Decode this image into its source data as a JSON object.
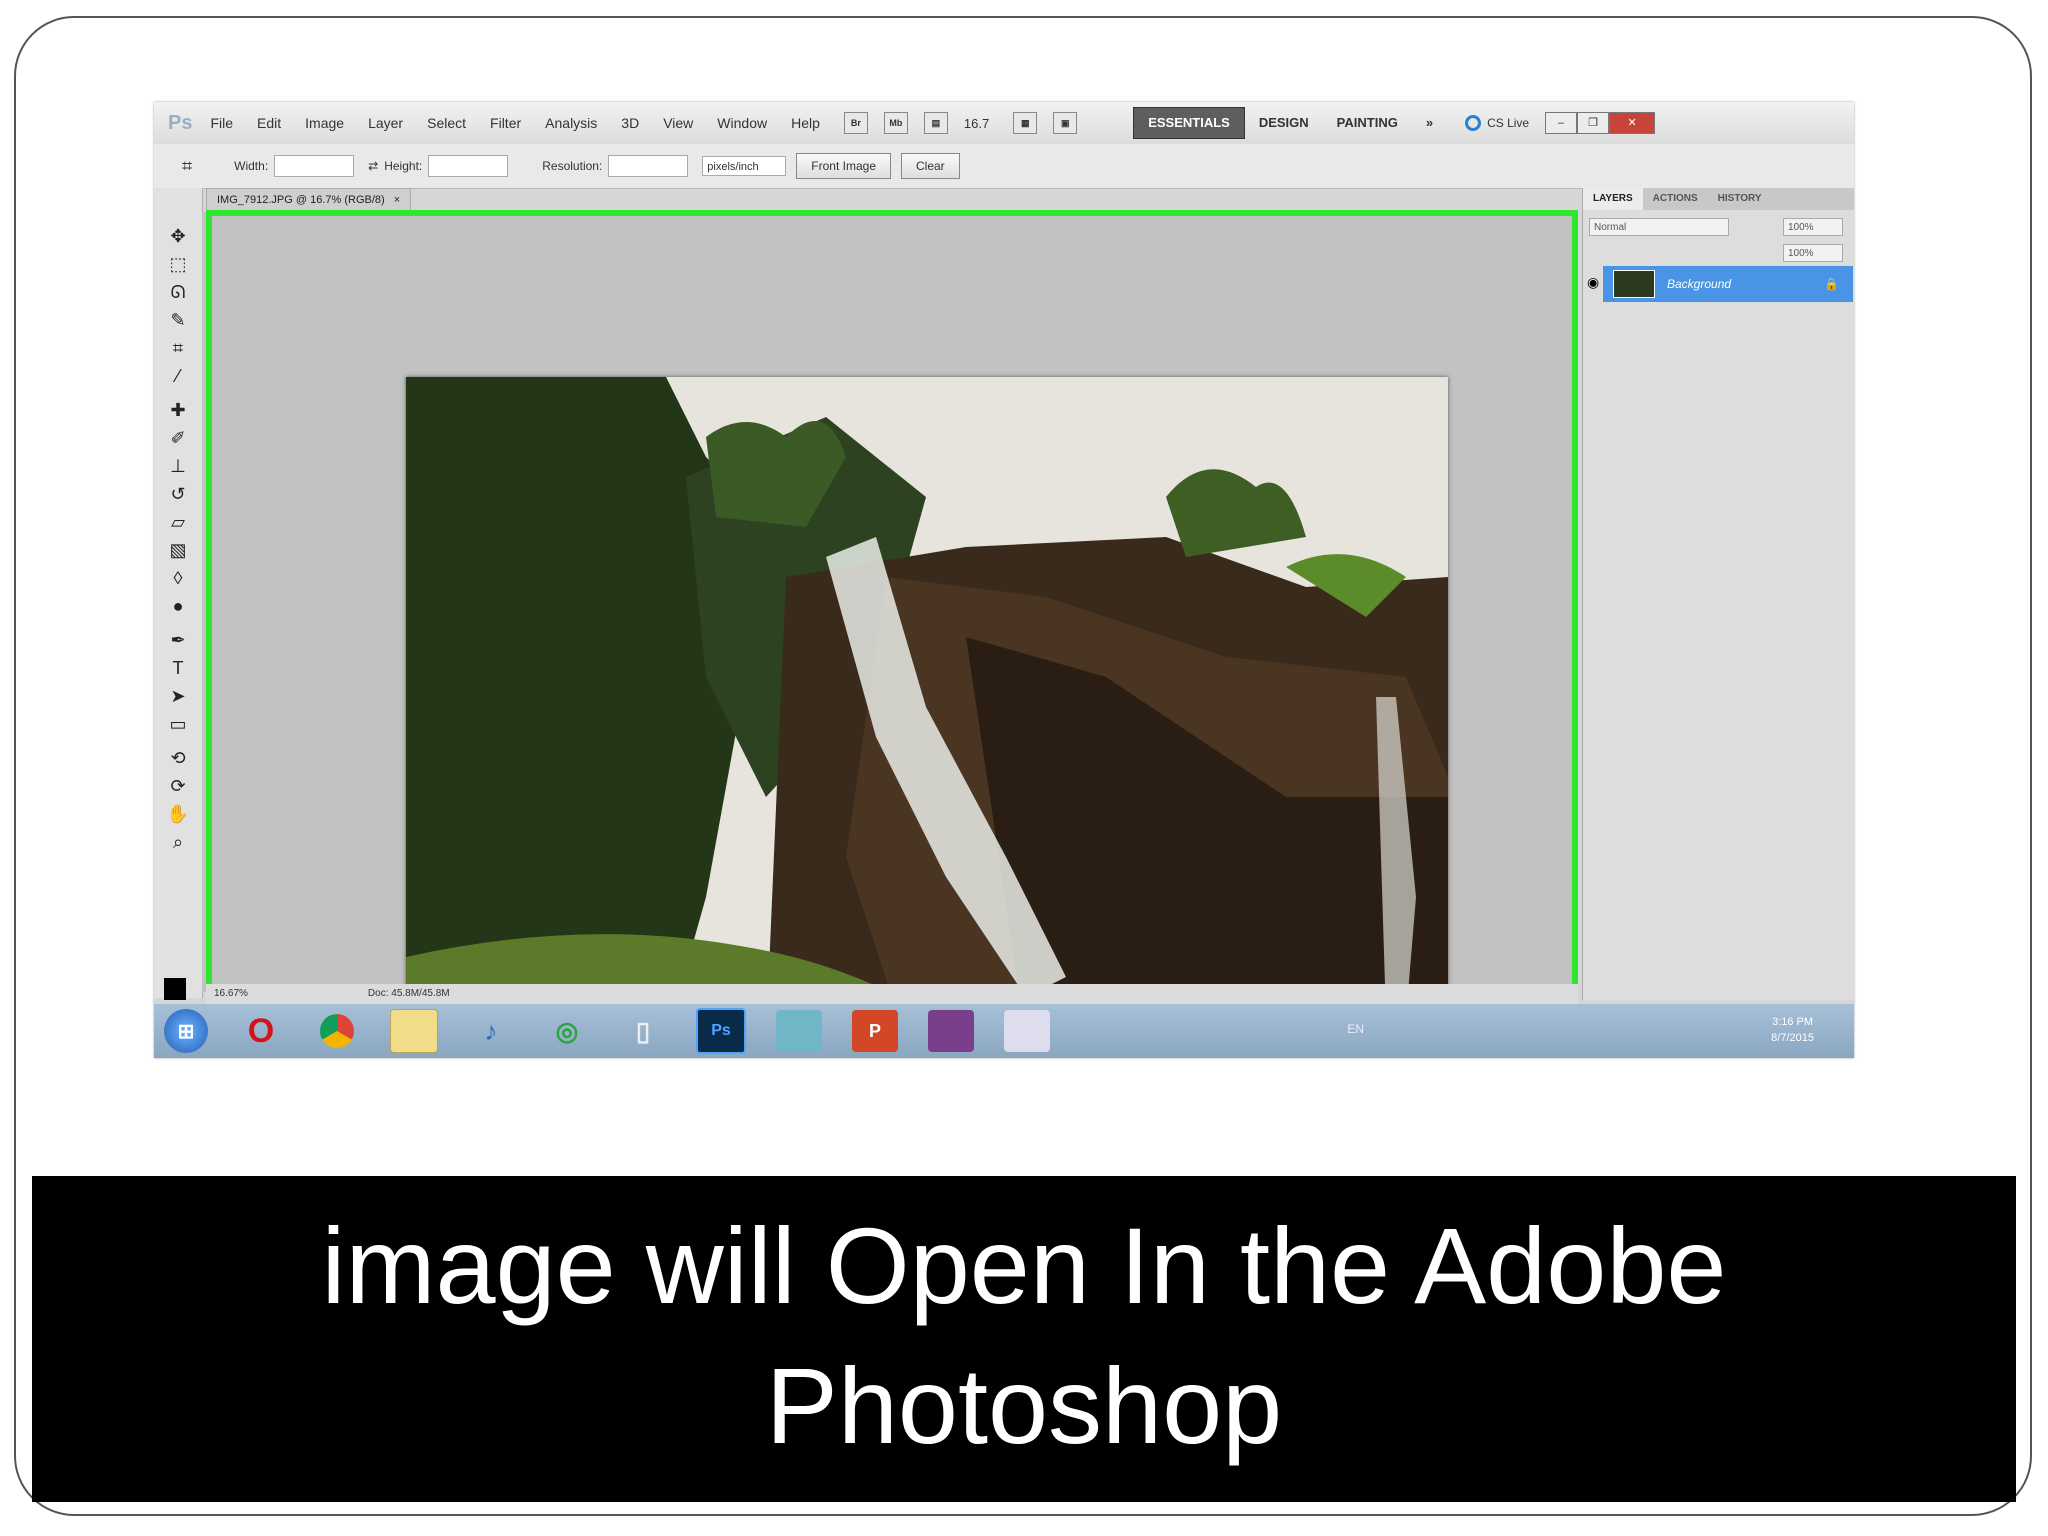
{
  "caption": {
    "line1": "image will Open In the Adobe",
    "line2": "Photoshop"
  },
  "photoshop": {
    "app_logo": "Ps",
    "menu": [
      "File",
      "Edit",
      "Image",
      "Layer",
      "Select",
      "Filter",
      "Analysis",
      "3D",
      "View",
      "Window",
      "Help"
    ],
    "zoom_dropdown": "16.7",
    "workspaces": [
      "ESSENTIALS",
      "DESIGN",
      "PAINTING"
    ],
    "more_label": "»",
    "cs_live": "CS Live",
    "options_bar": {
      "width_label": "Width:",
      "height_label": "Height:",
      "resolution_label": "Resolution:",
      "units": "pixels/inch",
      "front_image_button": "Front Image",
      "clear_button": "Clear"
    },
    "document_tab": "IMG_7912.JPG @ 16.7% (RGB/8)",
    "status": {
      "zoom": "16.67%",
      "doc_size": "Doc: 45.8M/45.8M"
    },
    "layers_panel": {
      "tabs": [
        "LAYERS",
        "ACTIONS",
        "HISTORY"
      ],
      "blend_mode": "Normal",
      "opacity": "100%",
      "fill": "100%",
      "layer_name": "Background"
    }
  },
  "taskbar": {
    "lang": "EN",
    "time": "3:16 PM",
    "date": "8/7/2015",
    "ps_label": "Ps"
  },
  "colors": {
    "highlight": "#2ee62e",
    "caption_bg": "#000000",
    "caption_text": "#ffffff"
  }
}
